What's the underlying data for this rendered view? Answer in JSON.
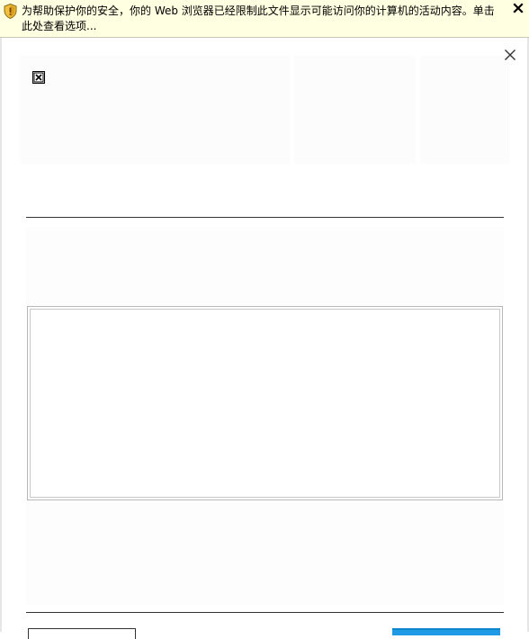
{
  "infobar": {
    "message": "为帮助保护你的安全，你的 Web 浏览器已经限制此文件显示可能访问你的计算机的活动内容。单击此处查看选项...",
    "shield_icon": "shield-warning-icon",
    "close_icon": "close-icon",
    "background": "#ffffe1"
  },
  "dialog": {
    "close_icon": "close-icon",
    "close_glyph": "X",
    "broken_image_icon": "broken-image-icon",
    "accent_button_color": "#1e9be4"
  }
}
